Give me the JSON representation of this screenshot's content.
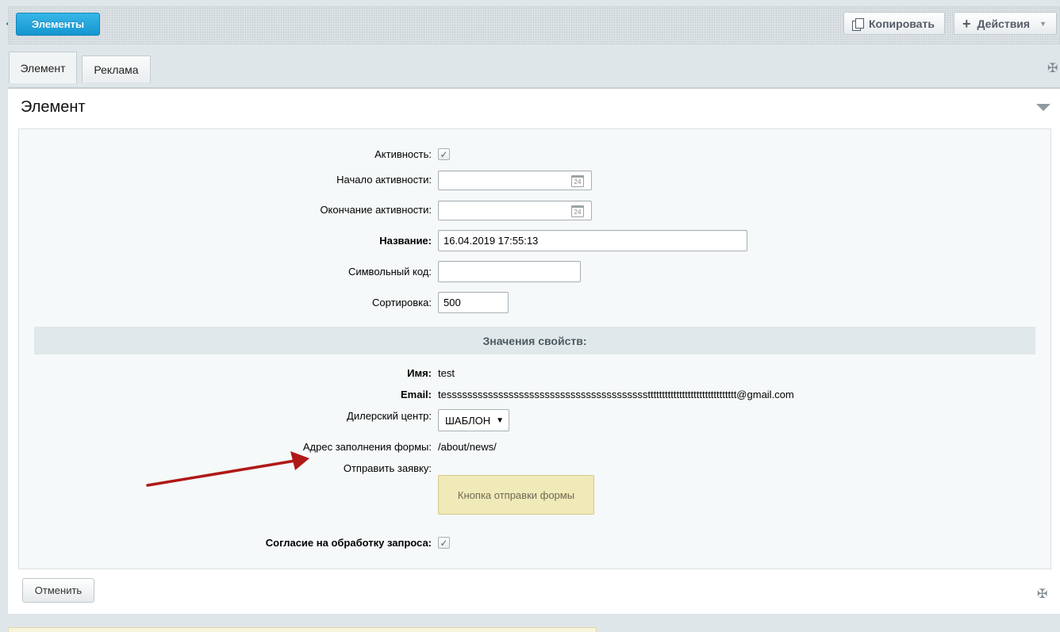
{
  "toolbar": {
    "back_label": "Элементы",
    "copy_label": "Копировать",
    "actions_label": "Действия"
  },
  "tabs": [
    {
      "label": "Элемент",
      "active": true
    },
    {
      "label": "Реклама",
      "active": false
    }
  ],
  "section": {
    "title": "Элемент"
  },
  "fields": {
    "active_label": "Активность:",
    "active_checked": true,
    "start_label": "Начало активности:",
    "start_value": "",
    "end_label": "Окончание активности:",
    "end_value": "",
    "name_label": "Название:",
    "name_value": "16.04.2019 17:55:13",
    "code_label": "Символьный код:",
    "code_value": "",
    "sort_label": "Сортировка:",
    "sort_value": "500"
  },
  "properties": {
    "header": "Значения свойств:",
    "name_label": "Имя:",
    "name_value": "test",
    "email_label": "Email:",
    "email_value": "tesssssssssssssssssssssssssssssssssssssssttttttttttttttttttttttttttttttt@gmail.com",
    "dealer_label": "Дилерский центр:",
    "dealer_value": "ШАБЛОН",
    "address_label": "Адрес заполнения формы:",
    "address_value": "/about/news/",
    "send_label": "Отправить заявку:",
    "send_button": "Кнопка отправки формы",
    "consent_label": "Согласие на обработку запроса:",
    "consent_checked": true
  },
  "calendar_icon_text": "24",
  "footer": {
    "cancel_label": "Отменить"
  },
  "colors": {
    "accent": "#1fa3da",
    "annotation_arrow": "#b01818",
    "form_button": "#f0e9b8"
  }
}
